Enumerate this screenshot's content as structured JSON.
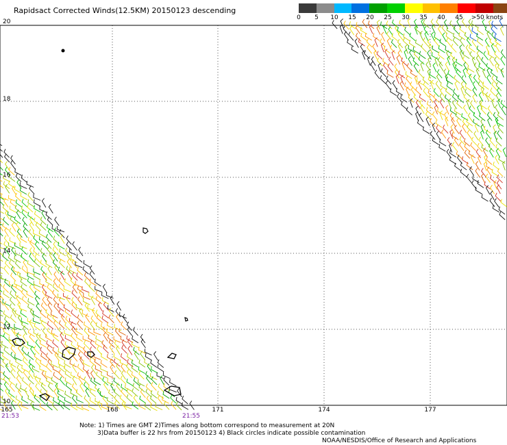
{
  "title": "Rapidsact Corrected Winds(12.5KM) 20150123 descending",
  "colorbar": {
    "labels": [
      "0",
      "5",
      "10",
      "15",
      "20",
      "25",
      "30",
      "35",
      "40",
      "45",
      ">50 knots"
    ],
    "colors": [
      "#3a3a3a",
      "#8c8c8c",
      "#00b8ff",
      "#0070e0",
      "#00a000",
      "#00d000",
      "#ffff00",
      "#ffc000",
      "#ff8000",
      "#ff0000",
      "#c00000",
      "#8b4513",
      "#a040a0",
      "#6010a0"
    ]
  },
  "map": {
    "lon_range": [
      165,
      179
    ],
    "lat_range": [
      10,
      20
    ],
    "lat_labels": [
      "20",
      "18",
      "16",
      "14",
      "12",
      "10"
    ],
    "lon_labels": [
      "165",
      "168",
      "171",
      "174",
      "177"
    ],
    "time_labels": [
      "21:53",
      "21:55"
    ]
  },
  "notes": {
    "line1": "Note: 1) Times are GMT 2)Times along bottom correspond to measurement at 20N",
    "line2": "3)Data buffer is 22 hrs from 20150123 4) Black circles indicate possible contamination",
    "credit": "NOAA/NESDIS/Office of Research and Applications"
  }
}
